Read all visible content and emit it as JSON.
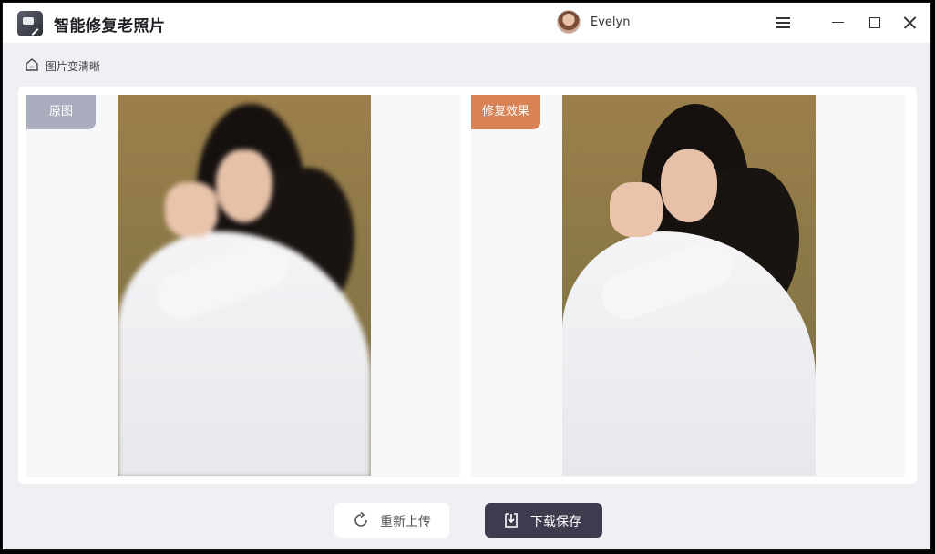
{
  "app": {
    "title": "智能修复老照片",
    "icon": "magic-wand-photo-icon"
  },
  "user": {
    "name": "Evelyn"
  },
  "window_controls": [
    "menu-icon",
    "minimize-icon",
    "maximize-icon",
    "close-icon"
  ],
  "breadcrumb": {
    "icon": "home-icon",
    "label": "图片变清晰"
  },
  "comparison": {
    "original": {
      "label": "原图",
      "badge_color": "#a9adbd"
    },
    "result": {
      "label": "修复效果",
      "badge_color": "#d98255"
    }
  },
  "actions": {
    "reupload": {
      "label": "重新上传",
      "icon": "refresh-icon"
    },
    "download": {
      "label": "下载保存",
      "icon": "download-icon",
      "color": "#3d3b4d"
    }
  }
}
